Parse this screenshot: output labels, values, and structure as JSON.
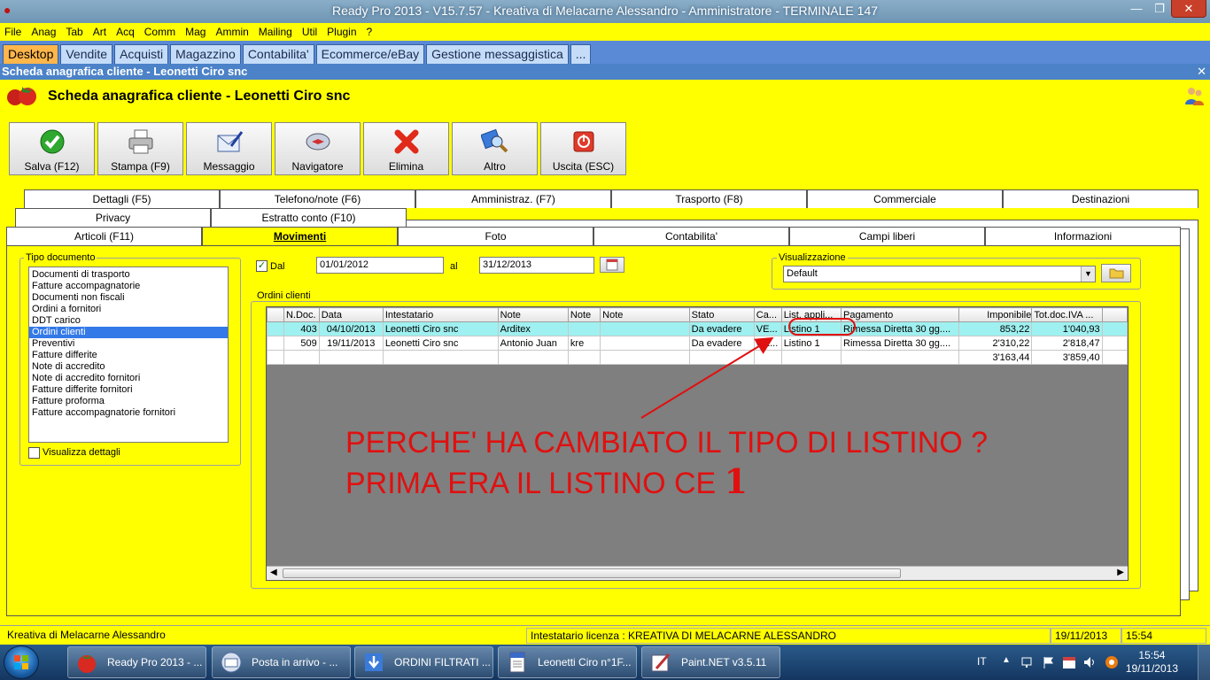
{
  "window": {
    "title": "Ready Pro 2013 - V15.7.57 - Kreativa di Melacarne Alessandro - Amministratore - TERMINALE 147"
  },
  "menu": [
    "File",
    "Anag",
    "Tab",
    "Art",
    "Acq",
    "Comm",
    "Mag",
    "Ammin",
    "Mailing",
    "Util",
    "Plugin",
    "?"
  ],
  "top_tabs": [
    "Desktop",
    "Vendite",
    "Acquisti",
    "Magazzino",
    "Contabilita'",
    "Ecommerce/eBay",
    "Gestione messaggistica",
    "..."
  ],
  "form": {
    "window_title": "Scheda anagrafica cliente - Leonetti Ciro snc",
    "heading": "Scheda anagrafica cliente - Leonetti Ciro snc"
  },
  "toolbar": [
    {
      "label": "Salva (F12)",
      "icon": "check-icon"
    },
    {
      "label": "Stampa (F9)",
      "icon": "printer-icon"
    },
    {
      "label": "Messaggio",
      "icon": "message-icon"
    },
    {
      "label": "Navigatore",
      "icon": "compass-icon"
    },
    {
      "label": "Elimina",
      "icon": "delete-icon"
    },
    {
      "label": "Altro",
      "icon": "magnifier-icon"
    },
    {
      "label": "Uscita (ESC)",
      "icon": "exit-icon"
    }
  ],
  "form_tabs": {
    "row1": [
      "Dettagli (F5)",
      "Telefono/note (F6)",
      "Amministraz. (F7)",
      "Trasporto (F8)",
      "Commerciale",
      "Destinazioni"
    ],
    "row2": [
      "Privacy",
      "Estratto conto (F10)"
    ],
    "row3": [
      "Articoli (F11)",
      "Movimenti",
      "Foto",
      "Contabilita'",
      "Campi liberi",
      "Informazioni"
    ]
  },
  "tipo_documento": {
    "label": "Tipo documento",
    "items": [
      "Documenti di trasporto",
      "Fatture accompagnatorie",
      "Documenti non fiscali",
      "Ordini a fornitori",
      "DDT carico",
      "Ordini clienti",
      "Preventivi",
      "Fatture differite",
      "Note di accredito",
      "Note di accredito fornitori",
      "Fatture differite fornitori",
      "Fatture proforma",
      "Fatture accompagnatorie fornitori"
    ],
    "selected": "Ordini clienti",
    "details_label": "Visualizza dettagli"
  },
  "filter": {
    "dal_label": "Dal",
    "dal_value": "01/01/2012",
    "al_label": "al",
    "al_value": "31/12/2013"
  },
  "visualizzazione": {
    "label": "Visualizzazione",
    "value": "Default"
  },
  "orders": {
    "label": "Ordini clienti",
    "columns": [
      "N.Doc.",
      "Data",
      "Intestatario",
      "Note",
      "Note",
      "Note",
      "Stato",
      "Ca...",
      "List. appli...",
      "Pagamento",
      "Imponibile",
      "Tot.doc.IVA ..."
    ],
    "rows": [
      [
        "403",
        "04/10/2013",
        "Leonetti Ciro snc",
        "Arditex",
        "",
        "",
        "Da evadere",
        "VE...",
        "Listino 1",
        "Rimessa Diretta 30 gg....",
        "853,22",
        "1'040,93"
      ],
      [
        "509",
        "19/11/2013",
        "Leonetti Ciro snc",
        "Antonio Juan",
        "kre",
        "",
        "Da evadere",
        "CE...",
        "Listino 1",
        "Rimessa Diretta 30 gg....",
        "2'310,22",
        "2'818,47"
      ]
    ],
    "totals": {
      "imponibile": "3'163,44",
      "totale": "3'859,40"
    }
  },
  "annotation": {
    "line1": "PERCHE' HA CAMBIATO IL TIPO DI LISTINO ?",
    "line2": "PRIMA ERA IL LISTINO CE",
    "digit": "1",
    "color": "#e01010"
  },
  "status": {
    "company": "Kreativa di Melacarne Alessandro",
    "license": "Intestatario licenza : KREATIVA DI MELACARNE ALESSANDRO",
    "date": "19/11/2013",
    "time": "15:54"
  },
  "taskbar": {
    "items": [
      "Ready Pro 2013 - ...",
      "Posta in arrivo - ...",
      "ORDINI FILTRATI ...",
      "Leonetti Ciro n°1F...",
      "Paint.NET v3.5.11"
    ],
    "lang": "IT",
    "clock_time": "15:54",
    "clock_date": "19/11/2013"
  },
  "colors": {
    "background": "#ffff00",
    "tabbar": "#5a8ad6",
    "selection": "#3379e8",
    "selected_row": "#9ff0f0"
  }
}
